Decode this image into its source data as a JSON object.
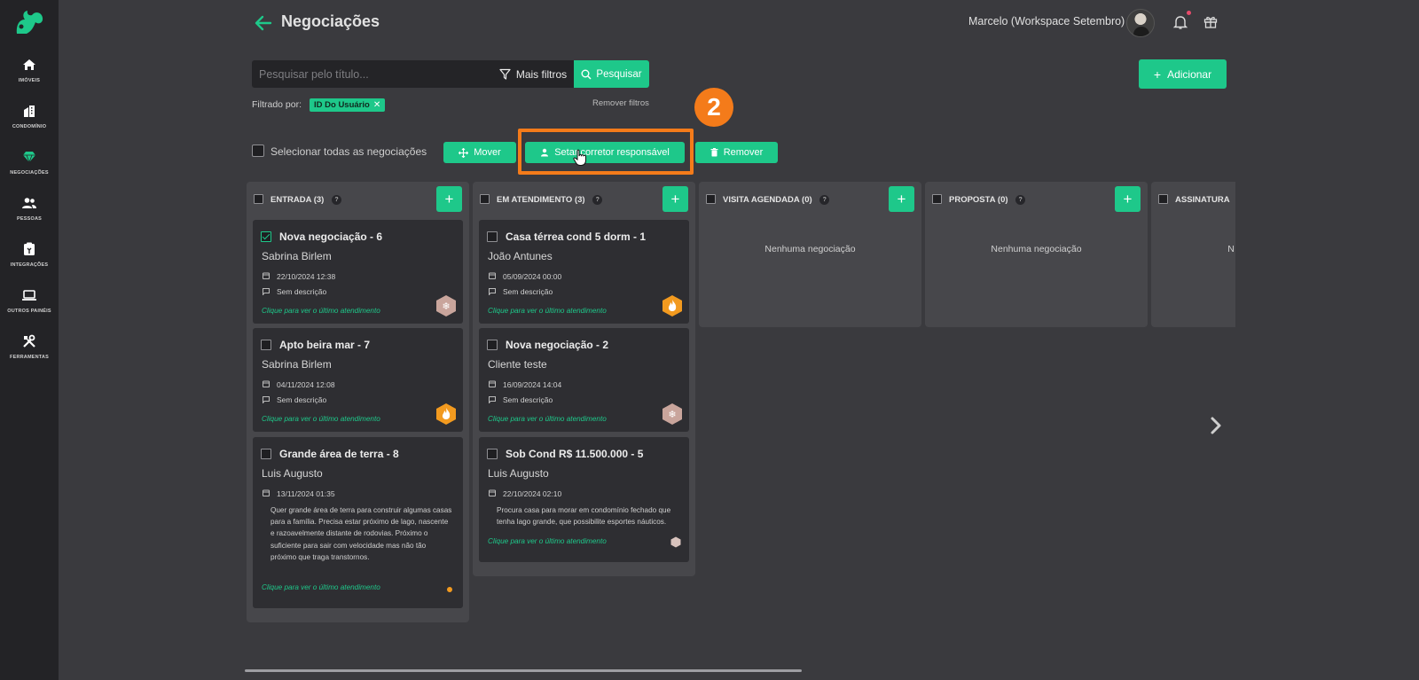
{
  "sidebar": {
    "items": [
      {
        "label": "IMÓVEIS",
        "icon": "home-icon"
      },
      {
        "label": "CONDOMÍNIO",
        "icon": "building-icon"
      },
      {
        "label": "NEGOCIAÇÕES",
        "icon": "diamond-icon"
      },
      {
        "label": "PESSOAS",
        "icon": "people-icon"
      },
      {
        "label": "INTEGRAÇÕES",
        "icon": "integrations-icon"
      },
      {
        "label": "OUTROS PAINÉIS",
        "icon": "laptop-icon"
      },
      {
        "label": "FERRAMENTAS",
        "icon": "tools-icon"
      }
    ]
  },
  "header": {
    "title": "Negociações",
    "user_name": "Marcelo (Workspace Setembro)"
  },
  "search": {
    "placeholder": "Pesquisar pelo título...",
    "filters_label": "Mais filtros",
    "search_label": "Pesquisar"
  },
  "add_label": "Adicionar",
  "filters": {
    "label": "Filtrado por:",
    "chip": "ID Do Usuário",
    "remove_label": "Remover filtros"
  },
  "bulk": {
    "select_all_label": "Selecionar todas as negociações",
    "mover_label": "Mover",
    "setar_label": "Setar corretor responsável",
    "remover_label": "Remover"
  },
  "annotation": {
    "step": "2"
  },
  "colors": {
    "accent": "#1ec88a",
    "highlight": "#f47b1a"
  },
  "columns": [
    {
      "title": "ENTRADA",
      "count": "(3)"
    },
    {
      "title": "EM ATENDIMENTO",
      "count": "(3)"
    },
    {
      "title": "VISITA AGENDADA",
      "count": "(0)",
      "empty": "Nenhuma negociação"
    },
    {
      "title": "PROPOSTA",
      "count": "(0)",
      "empty": "Nenhuma negociação"
    },
    {
      "title": "ASSINATURA",
      "count": "",
      "empty": "N"
    }
  ],
  "cards": [
    {
      "title": "Nova negociação - 6",
      "person": "Sabrina Birlem",
      "date": "22/10/2024 12:38",
      "desc": "Sem descrição",
      "link": "Clique para ver o último atendimento",
      "hex": "cold-hex-icon",
      "checked": true
    },
    {
      "title": "Apto beira mar - 7",
      "person": "Sabrina Birlem",
      "date": "04/11/2024 12:08",
      "desc": "Sem descrição",
      "link": "Clique para ver o último atendimento",
      "hex": "fire-hex-icon"
    },
    {
      "title": "Grande área de terra - 8",
      "person": "Luis Augusto",
      "date": "13/11/2024 01:35",
      "desc": "Quer grande área de terra para construir algumas casas para a família. Precisa estar próximo de lago, nascente e razoavelmente distante de rodovias. Próximo o suficiente para sair com velocidade mas não tão próximo que traga transtornos.",
      "link": "Clique para ver o último atendimento",
      "hex": "fire-dot-icon"
    },
    {
      "title": "Casa térrea cond 5 dorm - 1",
      "person": "João Antunes",
      "date": "05/09/2024 00:00",
      "desc": "Sem descrição",
      "link": "Clique para ver o último atendimento",
      "hex": "fire-hex-icon"
    },
    {
      "title": "Nova negociação - 2",
      "person": "Cliente teste",
      "date": "16/09/2024 14:04",
      "desc": "Sem descrição",
      "link": "Clique para ver o último atendimento",
      "hex": "cold-hex-icon"
    },
    {
      "title": "Sob Cond R$ 11.500.000 - 5",
      "person": "Luis Augusto",
      "date": "22/10/2024 02:10",
      "desc": "Procura casa para morar em condomínio fechado que tenha lago grande, que possibilite esportes náuticos.",
      "link": "Clique para ver o último atendimento",
      "hex": "cold-small-icon"
    }
  ]
}
